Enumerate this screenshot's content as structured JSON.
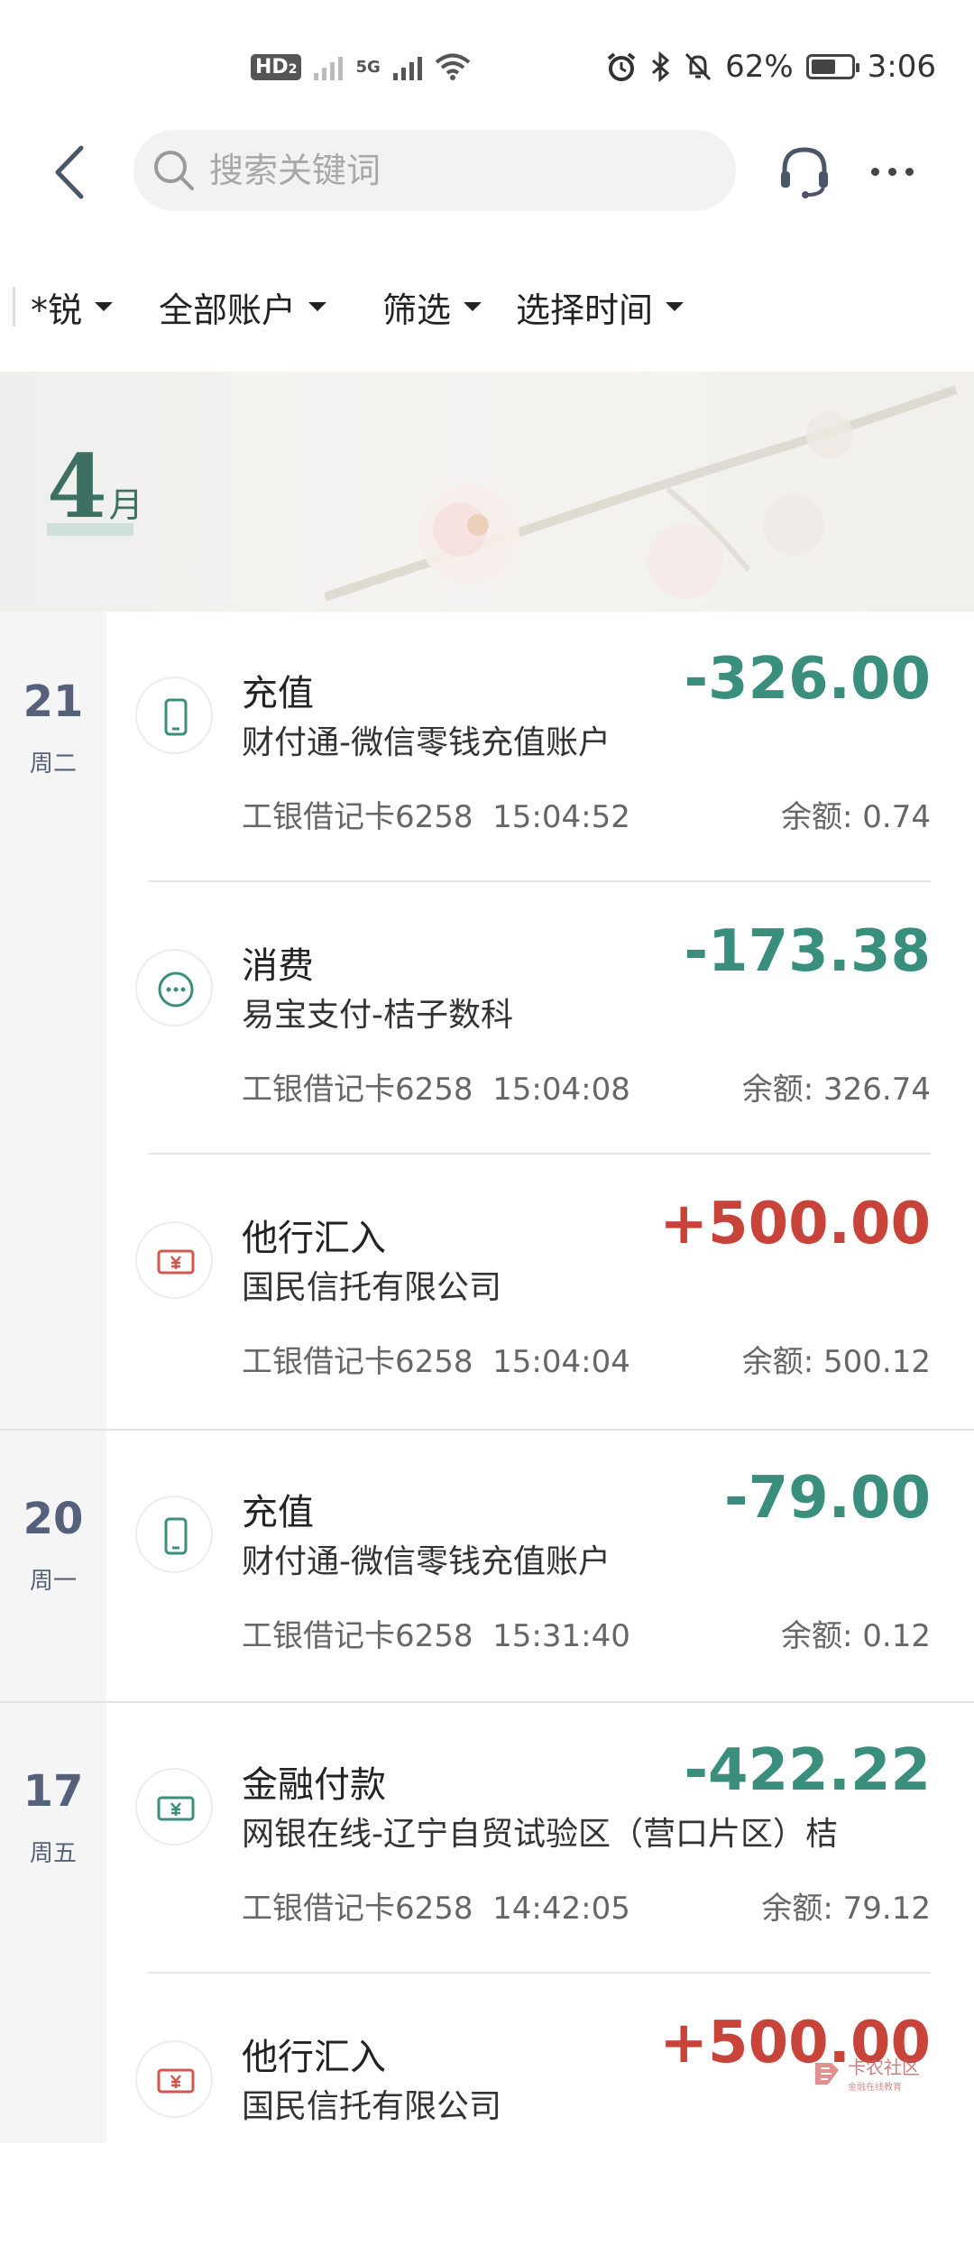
{
  "status_bar": {
    "hd_label": "HD",
    "hd_sub": "2",
    "net_label": "5G",
    "battery_text": "62%",
    "battery_level": 0.62,
    "time": "3:06"
  },
  "header": {
    "search_placeholder": "搜索关键词",
    "back_icon": "chevron-left-icon",
    "service_icon": "headset-icon",
    "more_icon": "more-icon"
  },
  "filters": [
    {
      "label": "*锐"
    },
    {
      "label": "全部账户"
    },
    {
      "label": "筛选"
    },
    {
      "label": "选择时间"
    }
  ],
  "banner": {
    "month_num": "4",
    "month_unit": "月"
  },
  "colors": {
    "negative": "#3a8f7c",
    "positive": "#c8443b",
    "accent": "#3d6f63"
  },
  "days": [
    {
      "day": "21",
      "weekday": "周二",
      "transactions": [
        {
          "icon": "phone-icon",
          "title": "充值",
          "counterparty": "财付通-微信零钱充值账户",
          "card": "工银借记卡6258",
          "time": "15:04:52",
          "amount": "-326.00",
          "balance": "余额: 0.74"
        },
        {
          "icon": "dots-icon",
          "title": "消费",
          "counterparty": "易宝支付-桔子数科",
          "card": "工银借记卡6258",
          "time": "15:04:08",
          "amount": "-173.38",
          "balance": "余额: 326.74"
        },
        {
          "icon": "money-icon",
          "title": "他行汇入",
          "counterparty": "国民信托有限公司",
          "card": "工银借记卡6258",
          "time": "15:04:04",
          "amount": "+500.00",
          "balance": "余额: 500.12"
        }
      ]
    },
    {
      "day": "20",
      "weekday": "周一",
      "transactions": [
        {
          "icon": "phone-icon",
          "title": "充值",
          "counterparty": "财付通-微信零钱充值账户",
          "card": "工银借记卡6258",
          "time": "15:31:40",
          "amount": "-79.00",
          "balance": "余额: 0.12"
        }
      ]
    },
    {
      "day": "17",
      "weekday": "周五",
      "transactions": [
        {
          "icon": "finance-icon",
          "title": "金融付款",
          "counterparty": "网银在线-辽宁自贸试验区（营口片区）桔",
          "card": "工银借记卡6258",
          "time": "14:42:05",
          "amount": "-422.22",
          "balance": "余额: 79.12"
        },
        {
          "icon": "money-icon",
          "title": "他行汇入",
          "counterparty": "国民信托有限公司",
          "card": "",
          "time": "",
          "amount": "+500.00",
          "balance": ""
        }
      ]
    }
  ],
  "watermark": {
    "text": "卡农社区",
    "sub": "金融在线教育"
  }
}
